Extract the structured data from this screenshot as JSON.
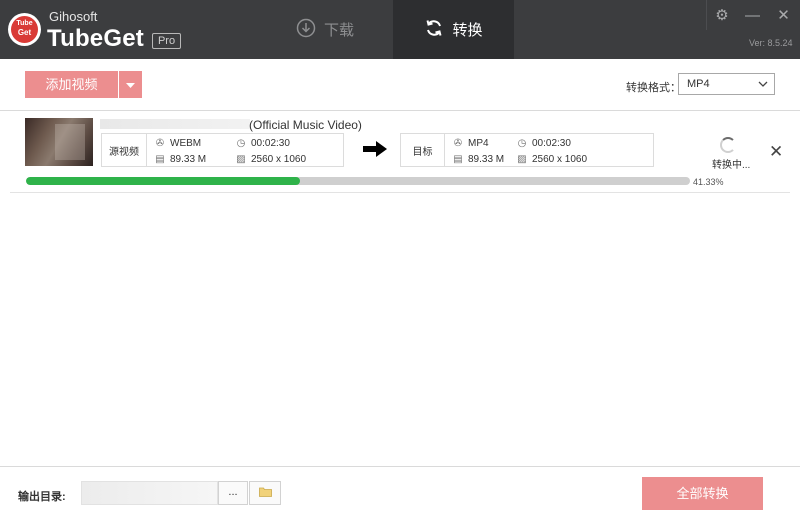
{
  "app": {
    "brand_small": "Gihosoft",
    "brand_big": "TubeGet",
    "pro_badge": "Pro",
    "logo_line1": "Tube",
    "logo_line2": "Get",
    "version": "Ver: 8.5.24",
    "colors": {
      "header_bg": "#3c3d3f",
      "accent": "#ec8e8f",
      "progress": "#2fb34a"
    }
  },
  "tabs": [
    {
      "label": "下载",
      "icon": "download-circle-icon",
      "active": false
    },
    {
      "label": "转换",
      "icon": "refresh-icon",
      "active": true
    }
  ],
  "window_controls": {
    "settings_icon": "gear-icon",
    "minimize_icon": "minimize-icon",
    "close_icon": "close-icon"
  },
  "toolbar": {
    "add_video_label": "添加视频",
    "format_label": "转换格式：",
    "format_value": "MP4"
  },
  "item": {
    "title_suffix": "(Official Music Video)",
    "source": {
      "label": "源视频",
      "format": "WEBM",
      "duration": "00:02:30",
      "size": "89.33 M",
      "resolution": "2560 x 1060"
    },
    "target": {
      "label": "目标",
      "format": "MP4",
      "duration": "00:02:30",
      "size": "89.33 M",
      "resolution": "2560 x 1060"
    },
    "status": "转换中...",
    "progress_fraction": 0.4133,
    "progress_text": "41.33%"
  },
  "footer": {
    "output_dir_label": "输出目录:",
    "browse_label": "...",
    "convert_all_label": "全部转换"
  }
}
